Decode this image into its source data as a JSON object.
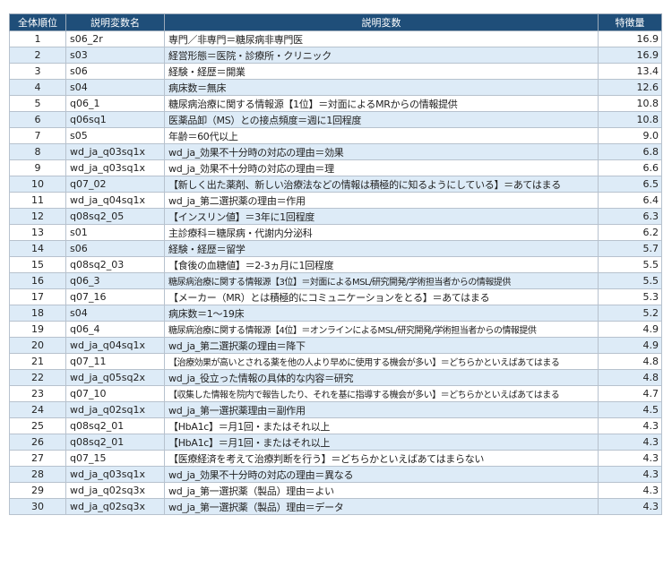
{
  "headers": {
    "rank": "全体順位",
    "var_name": "説明変数名",
    "var_desc": "説明変数",
    "importance": "特徴量"
  },
  "rows": [
    {
      "rank": "1",
      "var": "s06_2r",
      "desc": "専門／非専門＝糖尿病非専門医",
      "imp": "16.9"
    },
    {
      "rank": "2",
      "var": "s03",
      "desc": "経営形態＝医院・診療所・クリニック",
      "imp": "16.9"
    },
    {
      "rank": "3",
      "var": "s06",
      "desc": "経験・経歴＝開業",
      "imp": "13.4"
    },
    {
      "rank": "4",
      "var": "s04",
      "desc": "病床数＝無床",
      "imp": "12.6"
    },
    {
      "rank": "5",
      "var": "q06_1",
      "desc": "糖尿病治療に関する情報源【1位】＝対面によるMRからの情報提供",
      "imp": "10.8"
    },
    {
      "rank": "6",
      "var": "q06sq1",
      "desc": "医薬品卸（MS）との接点頻度＝週に1回程度",
      "imp": "10.8"
    },
    {
      "rank": "7",
      "var": "s05",
      "desc": "年齢＝60代以上",
      "imp": "9.0"
    },
    {
      "rank": "8",
      "var": "wd_ja_q03sq1x",
      "desc": "wd_ja_効果不十分時の対応の理由＝効果",
      "imp": "6.8"
    },
    {
      "rank": "9",
      "var": "wd_ja_q03sq1x",
      "desc": "wd_ja_効果不十分時の対応の理由＝理",
      "imp": "6.6"
    },
    {
      "rank": "10",
      "var": "q07_02",
      "desc": "【新しく出た薬剤、新しい治療法などの情報は積極的に知るようにしている】＝あてはまる",
      "imp": "6.5"
    },
    {
      "rank": "11",
      "var": "wd_ja_q04sq1x",
      "desc": "wd_ja_第二選択薬の理由＝作用",
      "imp": "6.4"
    },
    {
      "rank": "12",
      "var": "q08sq2_05",
      "desc": "【インスリン値】＝3年に1回程度",
      "imp": "6.3"
    },
    {
      "rank": "13",
      "var": "s01",
      "desc": "主診療科＝糖尿病・代謝内分泌科",
      "imp": "6.2"
    },
    {
      "rank": "14",
      "var": "s06",
      "desc": "経験・経歴＝留学",
      "imp": "5.7"
    },
    {
      "rank": "15",
      "var": "q08sq2_03",
      "desc": "【食後の血糖値】＝2-3ヵ月に1回程度",
      "imp": "5.5"
    },
    {
      "rank": "16",
      "var": "q06_3",
      "desc": "糖尿病治療に関する情報源【3位】＝対面によるMSL/研究開発/学術担当者からの情報提供",
      "imp": "5.5"
    },
    {
      "rank": "17",
      "var": "q07_16",
      "desc": "【メーカー（MR）とは積極的にコミュニケーションをとる】＝あてはまる",
      "imp": "5.3"
    },
    {
      "rank": "18",
      "var": "s04",
      "desc": "病床数＝1～19床",
      "imp": "5.2"
    },
    {
      "rank": "19",
      "var": "q06_4",
      "desc": "糖尿病治療に関する情報源【4位】＝オンラインによるMSL/研究開発/学術担当者からの情報提供",
      "imp": "4.9"
    },
    {
      "rank": "20",
      "var": "wd_ja_q04sq1x",
      "desc": "wd_ja_第二選択薬の理由＝降下",
      "imp": "4.9"
    },
    {
      "rank": "21",
      "var": "q07_11",
      "desc": "【治療効果が高いとされる薬を他の人より早めに使用する機会が多い】＝どちらかといえばあてはまる",
      "imp": "4.8"
    },
    {
      "rank": "22",
      "var": "wd_ja_q05sq2x",
      "desc": "wd_ja_役立った情報の具体的な内容＝研究",
      "imp": "4.8"
    },
    {
      "rank": "23",
      "var": "q07_10",
      "desc": "【収集した情報を院内で報告したり、それを基に指導する機会が多い】＝どちらかといえばあてはまる",
      "imp": "4.7"
    },
    {
      "rank": "24",
      "var": "wd_ja_q02sq1x",
      "desc": "wd_ja_第一選択薬理由＝副作用",
      "imp": "4.5"
    },
    {
      "rank": "25",
      "var": "q08sq2_01",
      "desc": "【HbA1c】＝月1回・またはそれ以上",
      "imp": "4.3"
    },
    {
      "rank": "26",
      "var": "q08sq2_01",
      "desc": "【HbA1c】＝月1回・またはそれ以上",
      "imp": "4.3"
    },
    {
      "rank": "27",
      "var": "q07_15",
      "desc": "【医療経済を考えて治療判断を行う】＝どちらかといえばあてはまらない",
      "imp": "4.3"
    },
    {
      "rank": "28",
      "var": "wd_ja_q03sq1x",
      "desc": "wd_ja_効果不十分時の対応の理由＝異なる",
      "imp": "4.3"
    },
    {
      "rank": "29",
      "var": "wd_ja_q02sq3x",
      "desc": "wd_ja_第一選択薬（製品）理由＝よい",
      "imp": "4.3"
    },
    {
      "rank": "30",
      "var": "wd_ja_q02sq3x",
      "desc": "wd_ja_第一選択薬（製品）理由＝データ",
      "imp": "4.3"
    }
  ],
  "colors": {
    "header_bg": "#1f4e79",
    "header_text": "#ffffff",
    "alt_row_bg": "#ddebf7",
    "border": "#b7c2ce"
  }
}
